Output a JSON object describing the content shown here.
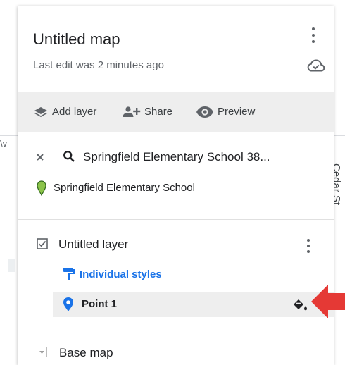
{
  "map": {
    "road_label_left": "\\v",
    "road_label_right": "Cedar St"
  },
  "panel": {
    "title": "Untitled map",
    "subtitle": "Last edit was 2 minutes ago",
    "more_icon": "more-vert-icon",
    "cloud_icon": "cloud-done-icon"
  },
  "toolbar": {
    "add_layer": "Add layer",
    "share": "Share",
    "preview": "Preview"
  },
  "search": {
    "query": "Springfield Elementary School 38...",
    "result": "Springfield Elementary School",
    "result_pin_color": "#8bc34a"
  },
  "layer": {
    "title": "Untitled layer",
    "checked": true,
    "styles_label": "Individual styles",
    "styles_color": "#1a73e8",
    "point_label": "Point 1",
    "point_pin_color": "#1a73e8"
  },
  "basemap": {
    "label": "Base map"
  },
  "annotation": {
    "arrow_color": "#e53935"
  }
}
